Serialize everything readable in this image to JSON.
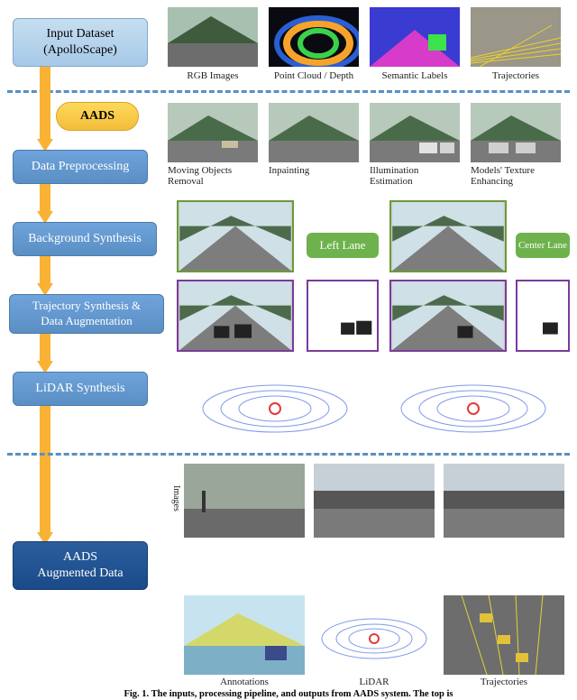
{
  "input_box": "Input Dataset\n(ApolloScape)",
  "aads_pill": "AADS",
  "steps": {
    "preproc": "Data Preprocessing",
    "bgsynth": "Background Synthesis",
    "traj": "Trajectory Synthesis &\nData Augmentation",
    "lidar": "LiDAR Synthesis",
    "final": "AADS\nAugmented Data"
  },
  "top_captions": [
    "RGB Images",
    "Point Cloud / Depth",
    "Semantic Labels",
    "Trajectories"
  ],
  "preproc_captions": [
    "Moving Objects\nRemoval",
    "Inpainting",
    "Illumination\nEstimation",
    "Models' Texture\nEnhancing"
  ],
  "lanes": {
    "left": "Left Lane",
    "center": "Center Lane"
  },
  "bottom_vcaption": "Images",
  "bottom_captions": [
    "Annotations",
    "LiDAR",
    "Trajectories"
  ],
  "fig_title": "Fig. 1. The inputs, processing pipeline, and outputs from AADS system. The top is"
}
